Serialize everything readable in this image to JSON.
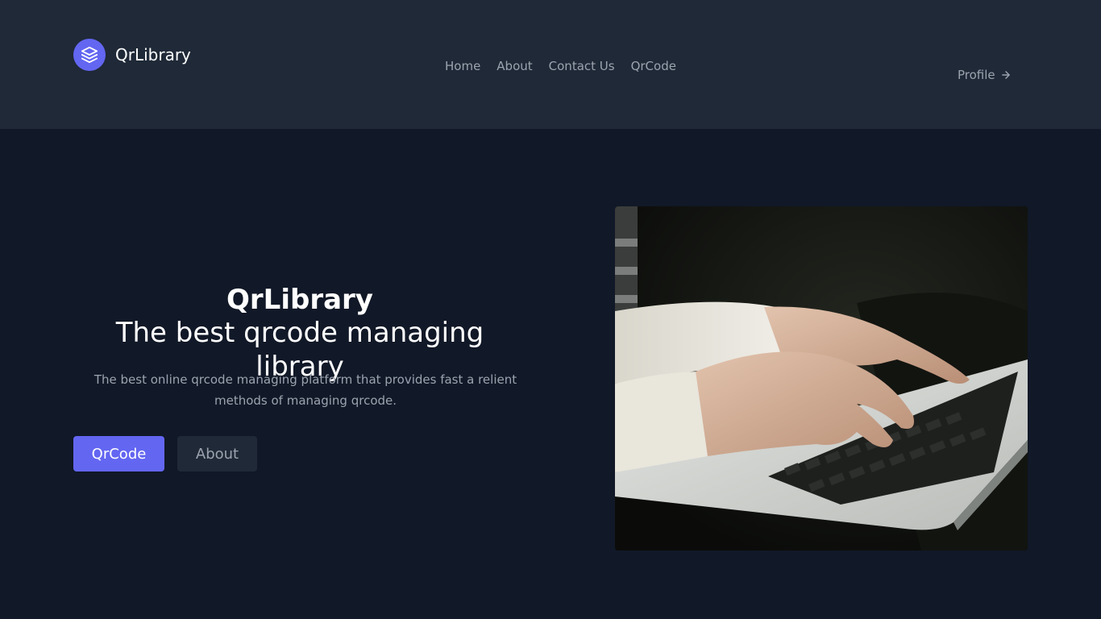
{
  "header": {
    "brand": {
      "name": "QrLibrary",
      "icon": "layers-icon"
    },
    "nav": [
      {
        "label": "Home"
      },
      {
        "label": "About"
      },
      {
        "label": "Contact Us"
      },
      {
        "label": "QrCode"
      }
    ],
    "profile": {
      "label": "Profile",
      "icon": "arrow-right-icon"
    }
  },
  "hero": {
    "title_line1": "QrLibrary",
    "title_line2": "The best qrcode managing library",
    "description": "The best online qrcode managing platform that provides fast a relient methods of managing qrcode.",
    "buttons": {
      "primary": "QrCode",
      "secondary": "About"
    },
    "image": {
      "subject": "hands typing on laptop keyboard"
    }
  },
  "colors": {
    "accent": "#6366f1",
    "header_bg": "#1f2937",
    "page_bg": "#111827",
    "muted_text": "#9ca3af",
    "heading_text": "#ffffff"
  }
}
